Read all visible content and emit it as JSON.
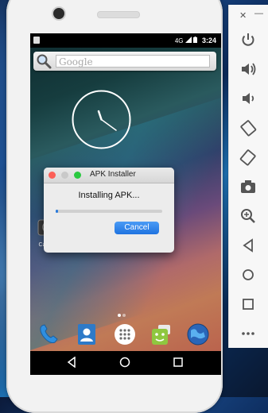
{
  "status_bar": {
    "time": "3:24",
    "signal_icons": "4G"
  },
  "search": {
    "placeholder": "Google"
  },
  "home": {
    "camera_label": "Camera"
  },
  "dialog": {
    "title": "APK Installer",
    "message": "Installing APK...",
    "progress": 0.02,
    "cancel_label": "Cancel",
    "colors": {
      "close": "#fc5f57",
      "minimize": "#c9c9c9",
      "zoom": "#2ac940",
      "accent": "#2a7bdc"
    }
  },
  "toolbar": {
    "close_glyph": "✕",
    "minimize_glyph": "—",
    "buttons": [
      "power-icon",
      "volume-up-icon",
      "volume-down-icon",
      "rotate-left-icon",
      "rotate-right-icon",
      "screenshot-icon",
      "zoom-icon",
      "back-icon",
      "home-icon",
      "overview-icon",
      "more-icon"
    ]
  },
  "dock": {
    "apps": [
      "phone-icon",
      "contacts-icon",
      "app-drawer-icon",
      "messenger-icon",
      "browser-icon"
    ]
  }
}
